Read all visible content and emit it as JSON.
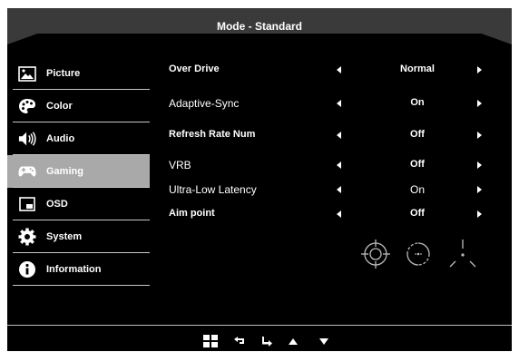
{
  "header": {
    "title": "Mode - Standard"
  },
  "sidebar": {
    "items": [
      {
        "label": "Picture",
        "icon": "picture-icon"
      },
      {
        "label": "Color",
        "icon": "palette-icon"
      },
      {
        "label": "Audio",
        "icon": "speaker-icon"
      },
      {
        "label": "Gaming",
        "icon": "gamepad-icon",
        "active": true
      },
      {
        "label": "OSD",
        "icon": "osd-window-icon"
      },
      {
        "label": "System",
        "icon": "gear-icon"
      },
      {
        "label": "Information",
        "icon": "info-icon"
      }
    ]
  },
  "settings": [
    {
      "name": "Over Drive",
      "value": "Normal"
    },
    {
      "name": "Adaptive-Sync",
      "value": "On"
    },
    {
      "name": "Refresh Rate Num",
      "value": "Off"
    },
    {
      "name": "VRB",
      "value": "Off"
    },
    {
      "name": "Ultra-Low Latency",
      "value": "On"
    },
    {
      "name": "Aim point",
      "value": "Off"
    }
  ],
  "aim_point_icons": [
    "crosshair-circle-dots-icon",
    "crosshair-circle-center-icon",
    "crosshair-tri-icon"
  ],
  "nav_buttons": [
    "menu-grid-icon",
    "back-arrow-icon",
    "enter-arrow-icon",
    "up-arrow-icon",
    "down-arrow-icon"
  ],
  "colors": {
    "background": "#000000",
    "title_bar": "#3a3a3a",
    "active_item": "#a9a9a9",
    "text": "#ffffff"
  }
}
